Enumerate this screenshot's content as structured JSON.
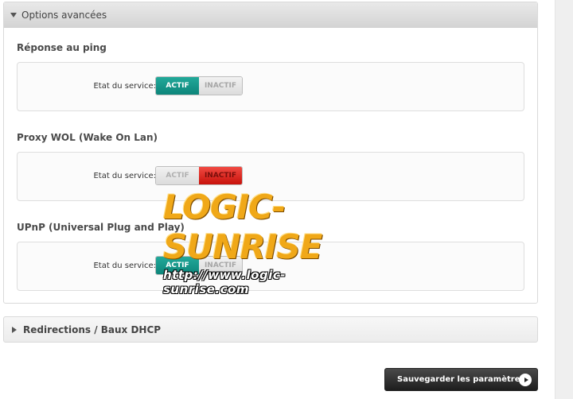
{
  "advanced": {
    "header_label": "Options avancées",
    "sections": [
      {
        "title": "Réponse au ping",
        "label": "Etat du service:",
        "on": "ACTIF",
        "off": "INACTIF",
        "state": "on"
      },
      {
        "title": "Proxy WOL (Wake On Lan)",
        "label": "Etat du service:",
        "on": "ACTIF",
        "off": "INACTIF",
        "state": "off"
      },
      {
        "title": "UPnP (Universal Plug and Play)",
        "label": "Etat du service:",
        "on": "ACTIF",
        "off": "INACTIF",
        "state": "on"
      }
    ]
  },
  "redirections": {
    "header_label": "Redirections / Baux DHCP"
  },
  "save_button": {
    "label": "Sauvegarder les paramètres"
  },
  "watermark": {
    "title": "LOGIC-SUNRISE",
    "url": "http://www.logic-sunrise.com"
  },
  "colors": {
    "active_on": "#0d857a",
    "active_off": "#c8120b"
  }
}
